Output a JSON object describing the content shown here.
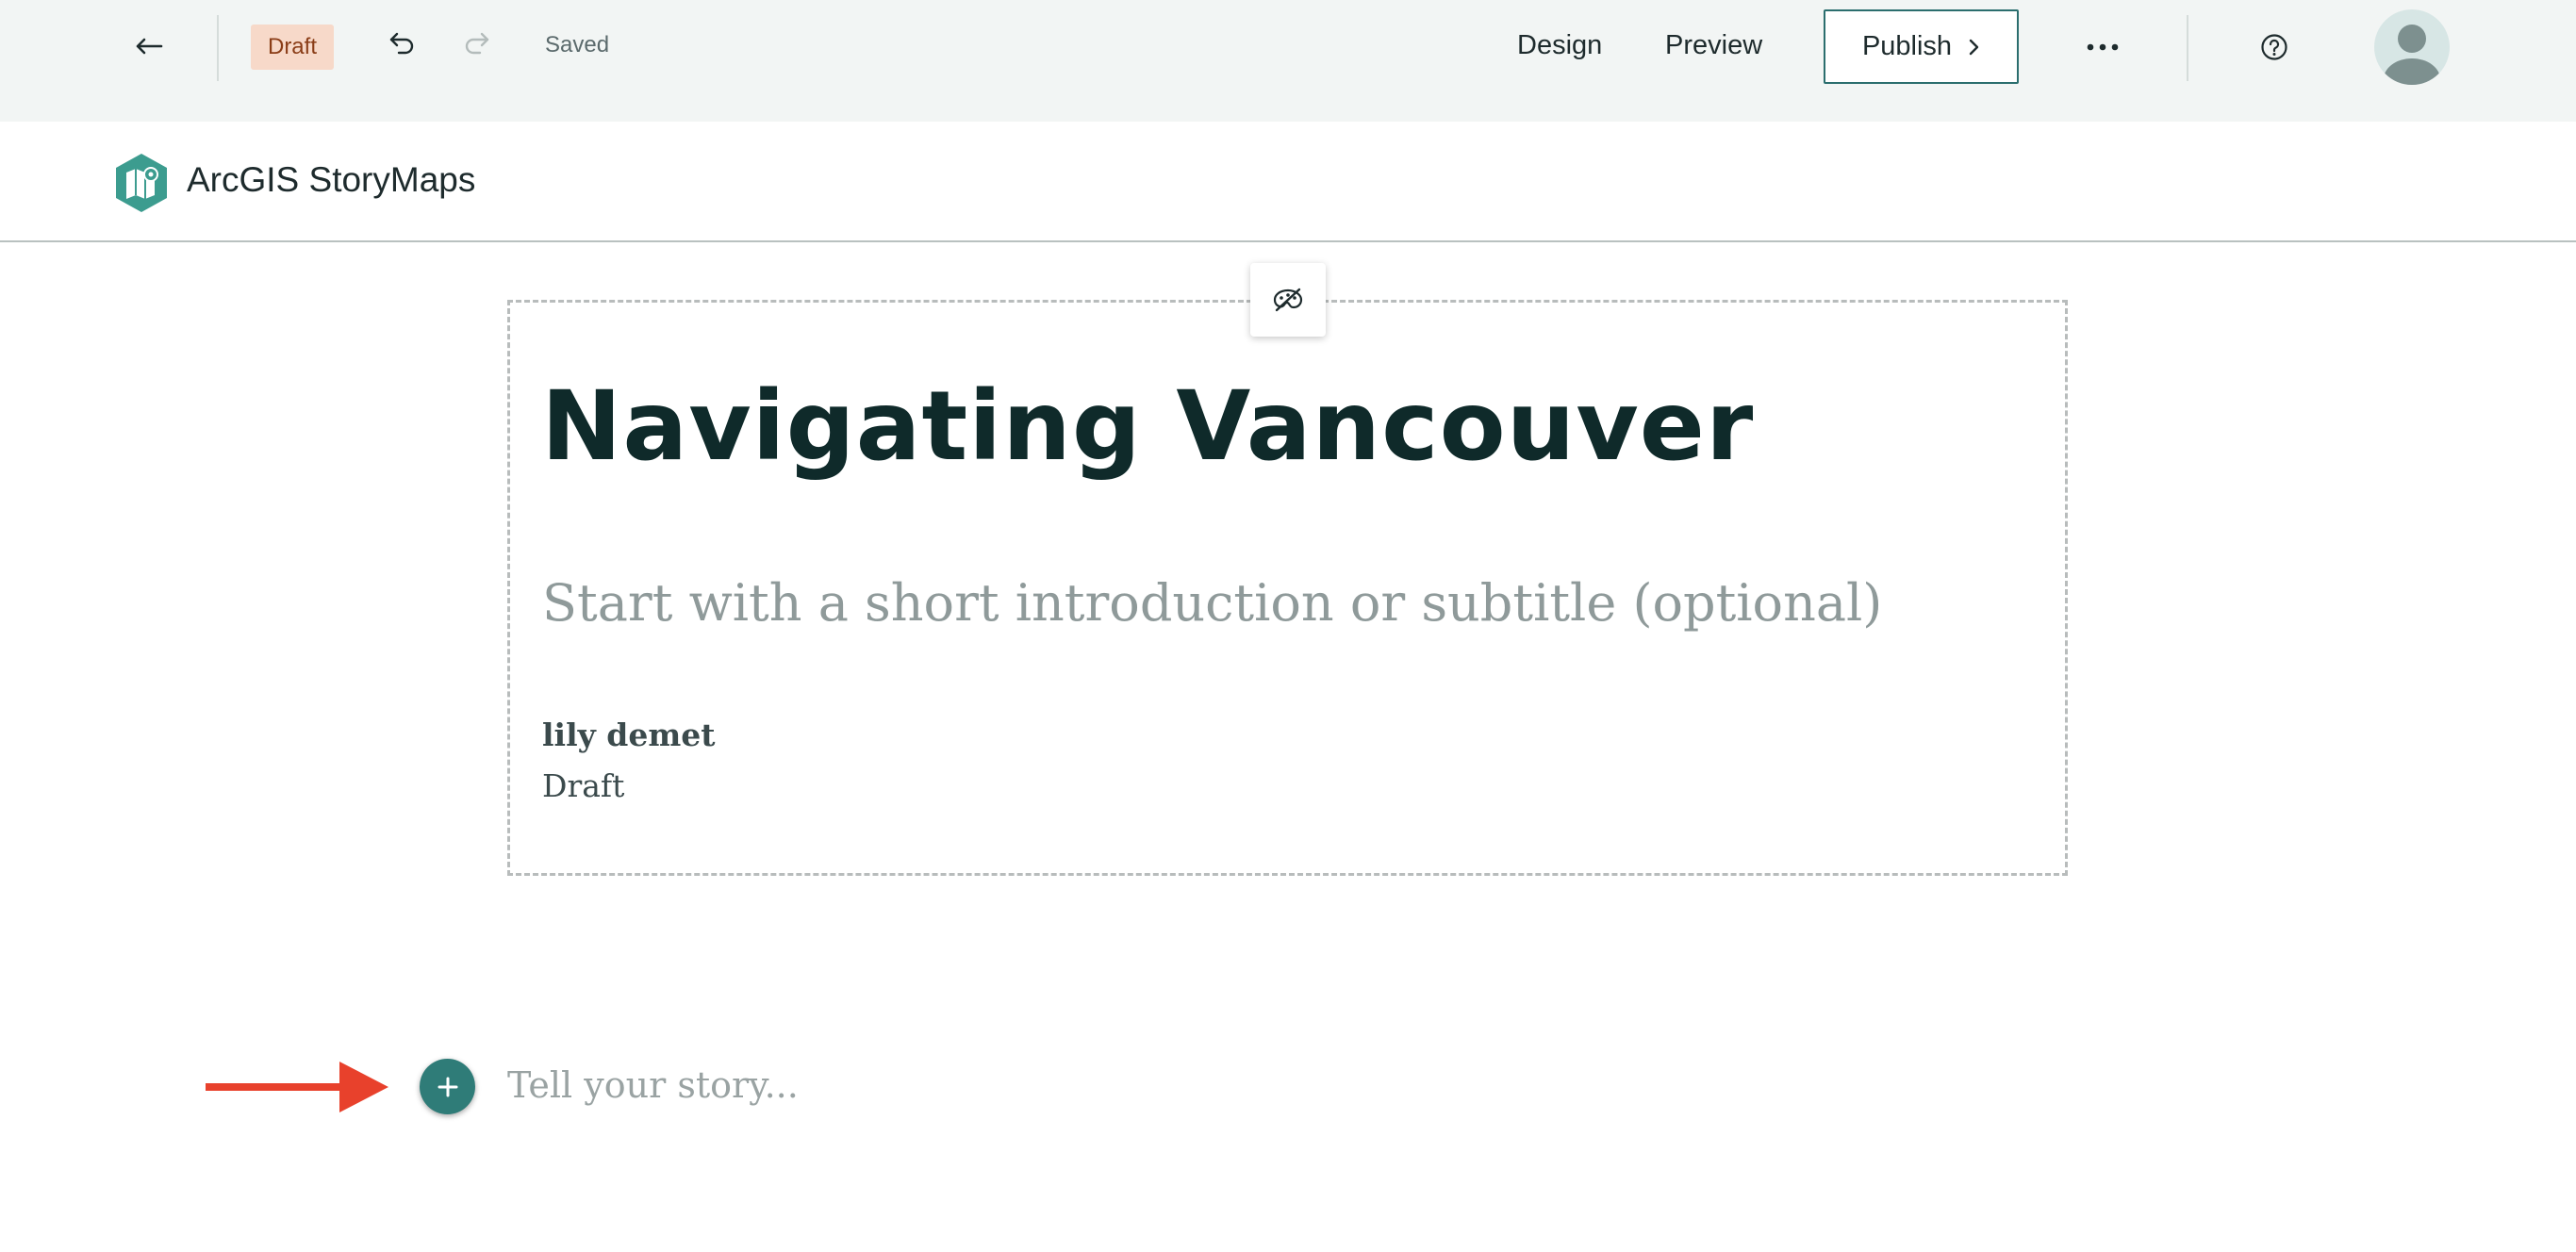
{
  "toolbar": {
    "back_icon": "arrow-left-icon",
    "status_badge": "Draft",
    "undo_icon": "undo-icon",
    "redo_icon": "redo-icon",
    "save_status": "Saved",
    "design_label": "Design",
    "preview_label": "Preview",
    "publish_label": "Publish",
    "more_icon": "ellipsis-icon",
    "help_icon": "help-icon",
    "avatar_icon": "user-avatar-icon"
  },
  "brand": {
    "name": "ArcGIS StoryMaps",
    "logo_icon": "storymaps-logo-icon"
  },
  "cover": {
    "design_toggle_icon": "palette-hidden-icon",
    "title": "Navigating Vancouver",
    "subtitle_placeholder": "Start with a short introduction or subtitle (optional)",
    "author": "lily demet",
    "status": "Draft"
  },
  "body": {
    "add_block_icon": "plus-icon",
    "pointer_arrow": "red-arrow-icon",
    "placeholder": "Tell your story..."
  },
  "colors": {
    "toolbar_bg": "#f2f5f4",
    "badge_bg": "#f7d9c9",
    "badge_text": "#8a3d17",
    "accent": "#2f7c78",
    "arrow": "#e8412c",
    "title_text": "#0f2a2a"
  }
}
